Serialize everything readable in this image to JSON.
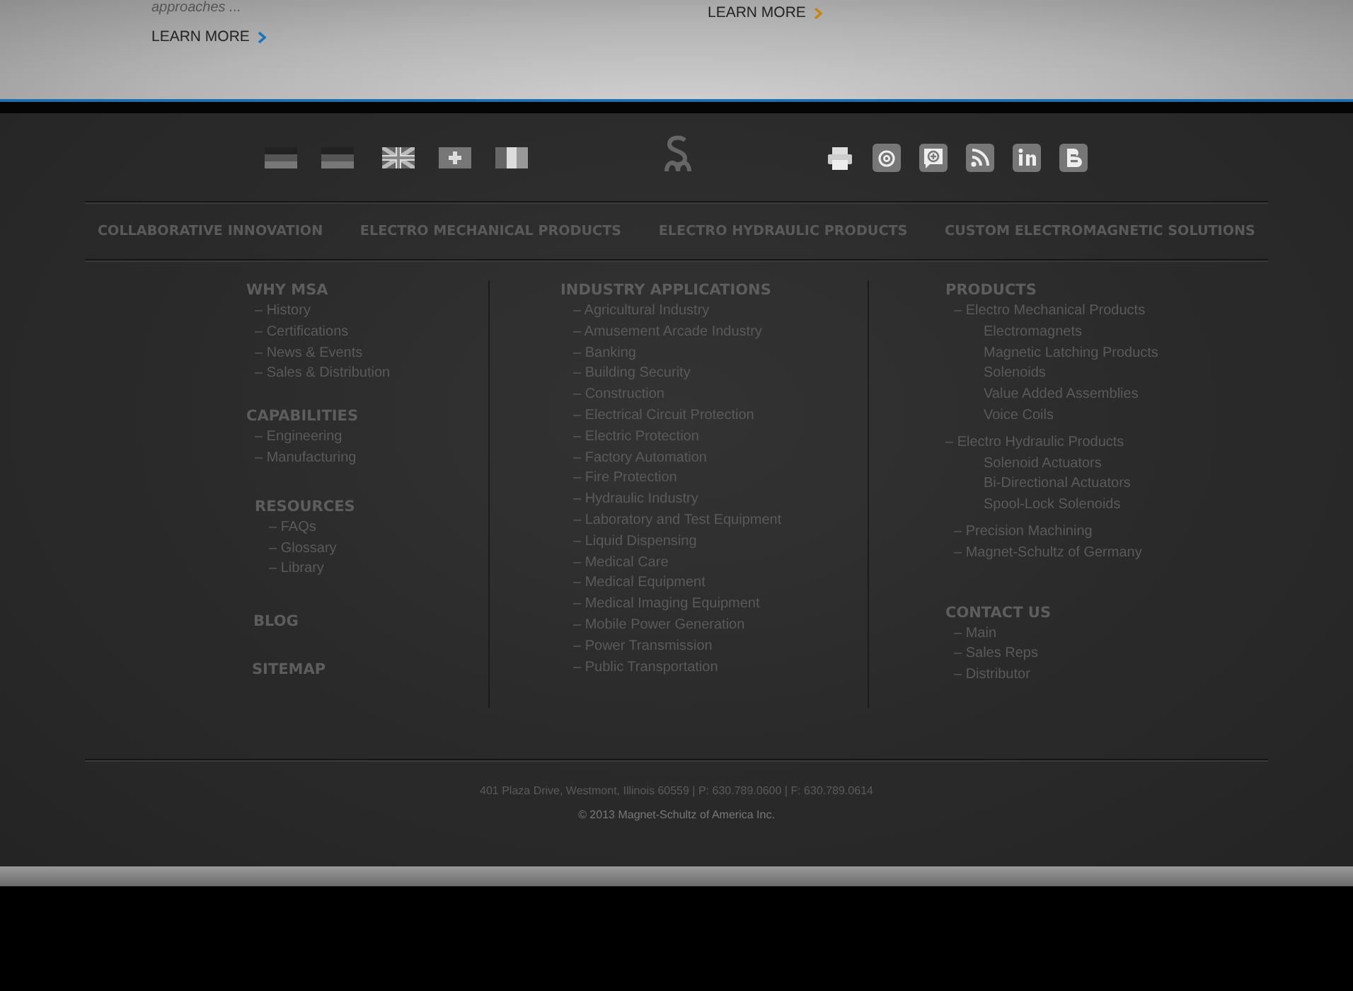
{
  "hero": {
    "excerpt": "approaches ...",
    "links": [
      {
        "label": "LEARN MORE",
        "color": "#1a73b8"
      },
      {
        "label": "LEARN MORE",
        "color": "#c8860f"
      }
    ]
  },
  "nav": [
    "COLLABORATIVE INNOVATION",
    "ELECTRO MECHANICAL PRODUCTS",
    "ELECTRO HYDRAULIC PRODUCTS",
    "CUSTOM ELECTROMAGNETIC SOLUTIONS"
  ],
  "columns": [
    {
      "sections": [
        {
          "title": "WHY MSA",
          "items": [
            {
              "label": "– History"
            },
            {
              "label": "– Certifications"
            },
            {
              "label": "– News & Events"
            },
            {
              "label": "– Sales & Distribution"
            }
          ]
        },
        {
          "title": "CAPABILITIES",
          "items": [
            {
              "label": "– Engineering"
            },
            {
              "label": "– Manufacturing"
            }
          ]
        },
        {
          "title": "RESOURCES",
          "items": [
            {
              "label": "– FAQs"
            },
            {
              "label": "– Glossary"
            },
            {
              "label": "– Library"
            }
          ]
        },
        {
          "title": "BLOG"
        },
        {
          "title": "SITEMAP"
        }
      ]
    },
    {
      "sections": [
        {
          "title": "INDUSTRY APPLICATIONS",
          "items": [
            {
              "label": "– Agricultural Industry"
            },
            {
              "label": "– Amusement Arcade Industry"
            },
            {
              "label": "– Banking"
            },
            {
              "label": "– Building Security"
            },
            {
              "label": "– Construction"
            },
            {
              "label": "– Electrical Circuit Protection"
            },
            {
              "label": "– Electric Protection"
            },
            {
              "label": "– Factory Automation"
            },
            {
              "label": "– Fire Protection"
            },
            {
              "label": "– Hydraulic Industry"
            },
            {
              "label": "– Laboratory and Test Equipment"
            },
            {
              "label": "– Liquid Dispensing"
            },
            {
              "label": "– Medical Care"
            },
            {
              "label": "– Medical Equipment"
            },
            {
              "label": "– Medical Imaging Equipment"
            },
            {
              "label": "– Mobile Power Generation"
            },
            {
              "label": "– Power Transmission"
            },
            {
              "label": "– Public Transportation"
            }
          ]
        }
      ]
    },
    {
      "sections": [
        {
          "title": "PRODUCTS",
          "items": [
            {
              "label": "– Electro Mechanical Products",
              "children": [
                {
                  "label": "Electromagnets"
                },
                {
                  "label": "Magnetic Latching Products"
                },
                {
                  "label": "Solenoids"
                },
                {
                  "label": "Value Added Assemblies"
                },
                {
                  "label": "Voice Coils"
                }
              ]
            },
            {
              "label": "– Electro Hydraulic Products",
              "children": [
                {
                  "label": "Solenoid Actuators"
                },
                {
                  "label": "Bi-Directional Actuators"
                },
                {
                  "label": "Spool-Lock Solenoids"
                }
              ]
            },
            {
              "label": "– Precision Machining"
            },
            {
              "label": "– Magnet-Schultz of Germany"
            }
          ]
        },
        {
          "title": "CONTACT US",
          "items": [
            {
              "label": "– Main"
            },
            {
              "label": "– Sales Reps"
            },
            {
              "label": "– Distributor"
            }
          ]
        }
      ]
    }
  ],
  "address": "401 Plaza Drive, Westmont, Illinois 60559 | P: 630.789.0600 | F: 630.789.0614",
  "copyright": "© 2013 Magnet-Schultz of America Inc."
}
